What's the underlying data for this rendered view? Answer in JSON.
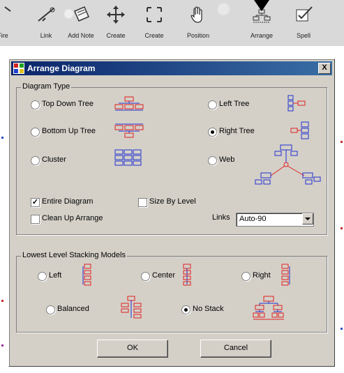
{
  "toolbar": {
    "items": [
      {
        "label": "Fire"
      },
      {
        "label": "Link"
      },
      {
        "label": "Add Note"
      },
      {
        "label": "Create"
      },
      {
        "label": "Create"
      },
      {
        "label": "Position"
      },
      {
        "label": "Arrange"
      },
      {
        "label": "Spell"
      }
    ]
  },
  "dialog": {
    "title": "Arrange Diagram",
    "close_label": "X",
    "diagram_type": {
      "legend": "Diagram Type",
      "options": [
        {
          "label": "Top Down Tree",
          "selected": false
        },
        {
          "label": "Left Tree",
          "selected": false
        },
        {
          "label": "Bottom Up Tree",
          "selected": false
        },
        {
          "label": "Right Tree",
          "selected": true
        },
        {
          "label": "Cluster",
          "selected": false
        },
        {
          "label": "Web",
          "selected": false
        }
      ],
      "entire_diagram": {
        "label": "Entire Diagram",
        "checked": true
      },
      "size_by_level": {
        "label": "Size By Level",
        "checked": false
      },
      "clean_up": {
        "label": "Clean Up Arrange",
        "checked": false
      },
      "links": {
        "label": "Links",
        "value": "Auto-90"
      }
    },
    "stacking": {
      "legend": "Lowest Level Stacking Models",
      "options": [
        {
          "label": "Left",
          "selected": false
        },
        {
          "label": "Center",
          "selected": false
        },
        {
          "label": "Right",
          "selected": false
        },
        {
          "label": "Balanced",
          "selected": false
        },
        {
          "label": "No Stack",
          "selected": true
        }
      ]
    },
    "ok_label": "OK",
    "cancel_label": "Cancel"
  },
  "colors": {
    "diagram_red": "#e02020",
    "diagram_blue": "#2030d0",
    "title_blue": "#0a246a"
  }
}
